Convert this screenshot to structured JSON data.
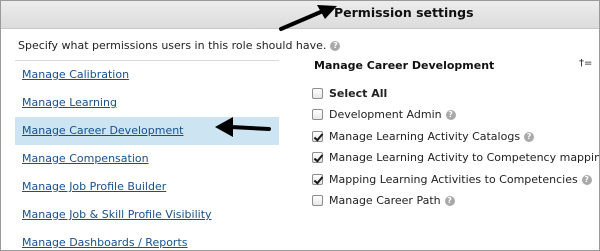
{
  "header": {
    "title": "Permission settings"
  },
  "intro": {
    "text": "Specify what permissions users in this role should have."
  },
  "nav": {
    "items": [
      {
        "label": "Manage Calibration"
      },
      {
        "label": "Manage Learning"
      },
      {
        "label": "Manage Career Development",
        "selected": true
      },
      {
        "label": "Manage Compensation"
      },
      {
        "label": "Manage Job Profile Builder"
      },
      {
        "label": "Manage Job & Skill Profile Visibility"
      },
      {
        "label": "Manage Dashboards / Reports"
      }
    ]
  },
  "panel": {
    "title": "Manage Career Development",
    "corner_text": "†= ",
    "permissions": [
      {
        "label": "Select All",
        "checked": false
      },
      {
        "label": "Development Admin",
        "checked": false
      },
      {
        "label": "Manage Learning Activity Catalogs",
        "checked": true
      },
      {
        "label": "Manage Learning Activity to Competency mappings",
        "checked": true
      },
      {
        "label": "Mapping Learning Activities to Competencies",
        "checked": true
      },
      {
        "label": "Manage Career Path",
        "checked": false
      }
    ]
  },
  "help_icon_glyph": "?",
  "colors": {
    "link": "#1a4f8a",
    "selected_row": "#cde4f3",
    "header_bg": "#e4e4e4"
  }
}
